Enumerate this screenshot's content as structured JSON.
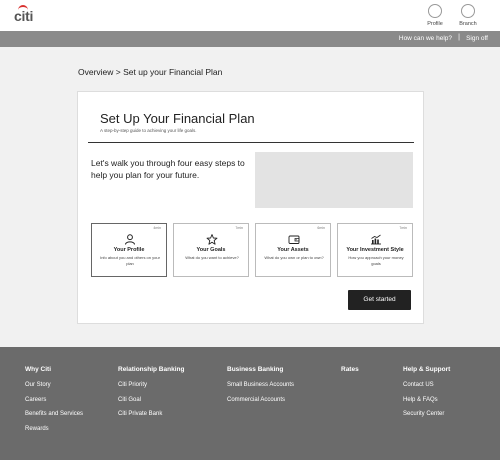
{
  "header": {
    "logo": "citi",
    "profile_label": "Profile",
    "branch_label": "Branch"
  },
  "utility_bar": {
    "help_label": "How can we help?",
    "separator": "|",
    "signoff_label": "Sign off"
  },
  "breadcrumb": "Overview > Set up your Financial Plan",
  "plan": {
    "title": "Set Up Your Financial Plan",
    "subtitle": "A step-by-step guide to achieving your life goals.",
    "intro": "Let's walk you through four easy steps to help you plan for your future.",
    "steps": [
      {
        "time": "4min",
        "title": "Your Profile",
        "desc": "Info about you and others on your plan",
        "icon": "person-icon"
      },
      {
        "time": "7min",
        "title": "Your Goals",
        "desc": "What do you want to achieve?",
        "icon": "star-icon"
      },
      {
        "time": "6min",
        "title": "Your Assets",
        "desc": "What do you own or plan to own?",
        "icon": "wallet-icon"
      },
      {
        "time": "7min",
        "title": "Your Investment Style",
        "desc": "How you approach your money goals",
        "icon": "chart-icon"
      }
    ],
    "cta_label": "Get started"
  },
  "footer": {
    "columns": [
      {
        "heading": "Why Citi",
        "links": [
          "Our Story",
          "Careers",
          "Benefits and Services",
          "Rewards"
        ]
      },
      {
        "heading": "Relationship Banking",
        "links": [
          "Citi Priority",
          "Citi Goal",
          "Citi Private Bank"
        ]
      },
      {
        "heading": "Business Banking",
        "links": [
          "Small Business Accounts",
          "Commercial Accounts"
        ]
      },
      {
        "heading": "Rates",
        "links": []
      },
      {
        "heading": "Help & Support",
        "links": [
          "Contact US",
          "Help & FAQs",
          "Security Center"
        ]
      }
    ]
  },
  "colors": {
    "accent_red": "#d9302e",
    "utility_bar": "#8a8a8a",
    "footer": "#6b6b6b",
    "cta": "#222222"
  }
}
